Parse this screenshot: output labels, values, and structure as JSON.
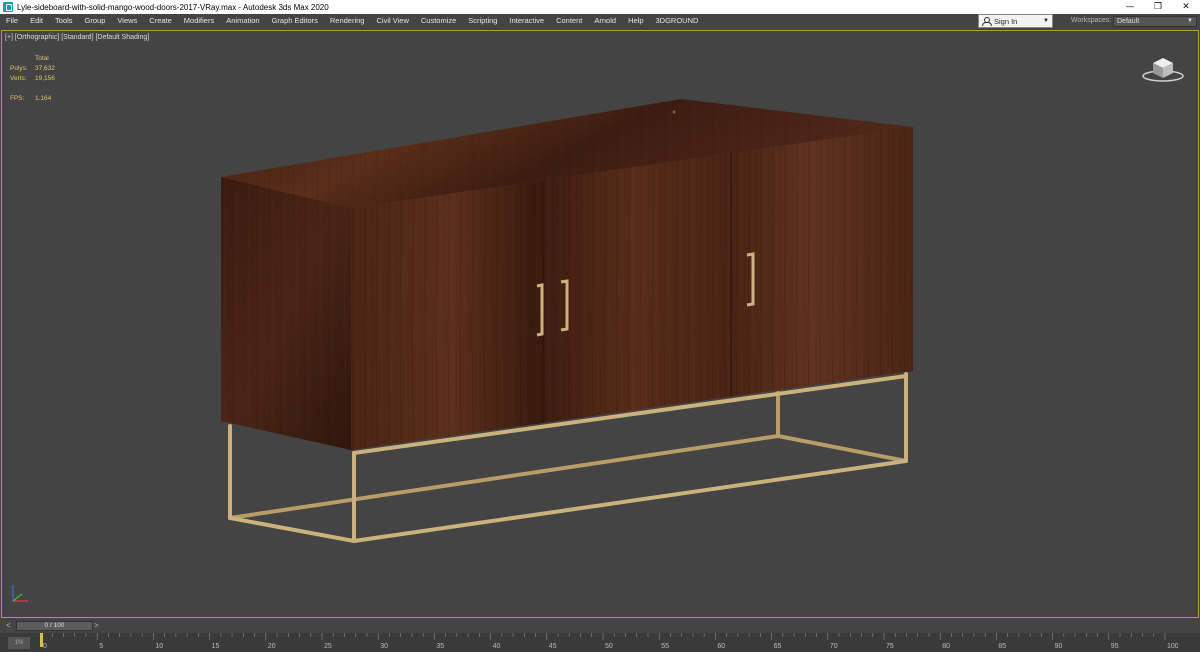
{
  "window": {
    "title": "Lyle-sideboard-with-solid-mango-wood-doors-2017-VRay.max - Autodesk 3ds Max 2020",
    "controls": {
      "minimize": "—",
      "restore": "❐",
      "close": "✕"
    }
  },
  "menu": {
    "items": [
      "File",
      "Edit",
      "Tools",
      "Group",
      "Views",
      "Create",
      "Modifiers",
      "Animation",
      "Graph Editors",
      "Rendering",
      "Civil View",
      "Customize",
      "Scripting",
      "Interactive",
      "Content",
      "Arnold",
      "Help",
      "3DGROUND"
    ],
    "sign_in": "Sign In",
    "workspaces_label": "Workspaces:",
    "workspace_value": "Default"
  },
  "viewport": {
    "label": "[+] [Orthographic] [Standard] [Default Shading]",
    "stats": {
      "total_label": "Total",
      "polys_label": "Polys:",
      "polys_value": "37,632",
      "verts_label": "Verts:",
      "verts_value": "19,156",
      "fps_label": "FPS:",
      "fps_value": "1.164"
    },
    "border_color": "#b49b3c",
    "background": "#444444",
    "object_colors": {
      "wood": "#4a2516",
      "frame": "#c9b07a"
    }
  },
  "timeline": {
    "frame_display": "0 / 100",
    "prev_label": "<",
    "next_label": ">",
    "ticks": [
      0,
      5,
      10,
      15,
      20,
      25,
      30,
      35,
      40,
      45,
      50,
      55,
      60,
      65,
      70,
      75,
      80,
      85,
      90,
      95,
      100
    ],
    "track_icon": "1%"
  }
}
